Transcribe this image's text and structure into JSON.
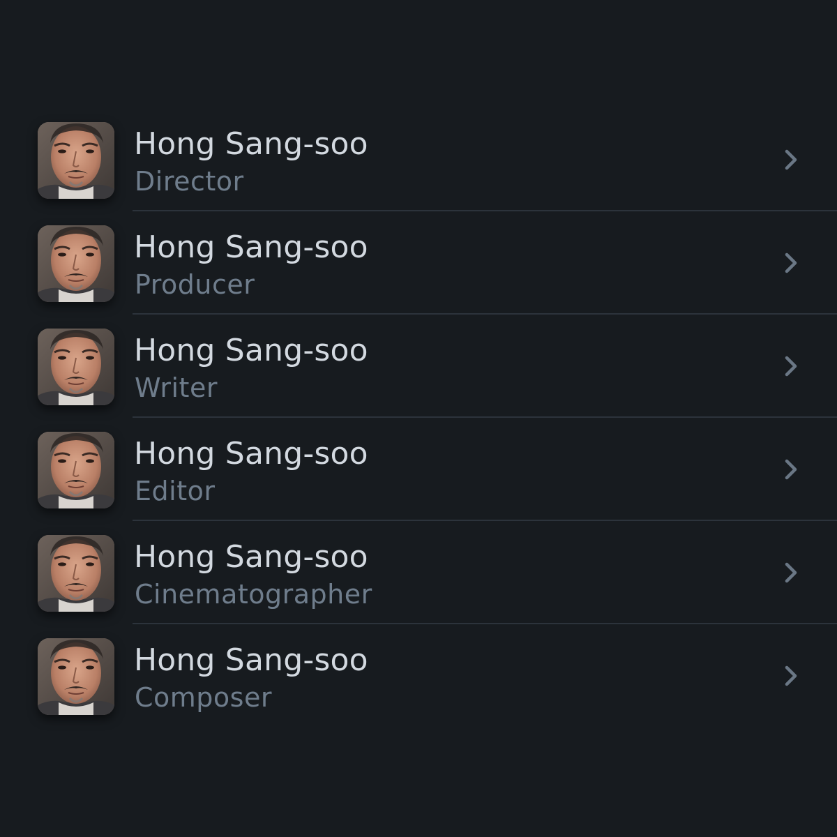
{
  "theme": {
    "background": "#171b1f",
    "name_color": "#d3d9e0",
    "role_color": "#6f7d8c",
    "divider_color": "#2c333b",
    "chevron_color": "#6a7785"
  },
  "crew": [
    {
      "name": "Hong Sang-soo",
      "role": "Director",
      "avatar_icon": "person-portrait-photo",
      "action_icon": "chevron-right-icon"
    },
    {
      "name": "Hong Sang-soo",
      "role": "Producer",
      "avatar_icon": "person-portrait-photo",
      "action_icon": "chevron-right-icon"
    },
    {
      "name": "Hong Sang-soo",
      "role": "Writer",
      "avatar_icon": "person-portrait-photo",
      "action_icon": "chevron-right-icon"
    },
    {
      "name": "Hong Sang-soo",
      "role": "Editor",
      "avatar_icon": "person-portrait-photo",
      "action_icon": "chevron-right-icon"
    },
    {
      "name": "Hong Sang-soo",
      "role": "Cinematographer",
      "avatar_icon": "person-portrait-photo",
      "action_icon": "chevron-right-icon"
    },
    {
      "name": "Hong Sang-soo",
      "role": "Composer",
      "avatar_icon": "person-portrait-photo",
      "action_icon": "chevron-right-icon"
    }
  ]
}
